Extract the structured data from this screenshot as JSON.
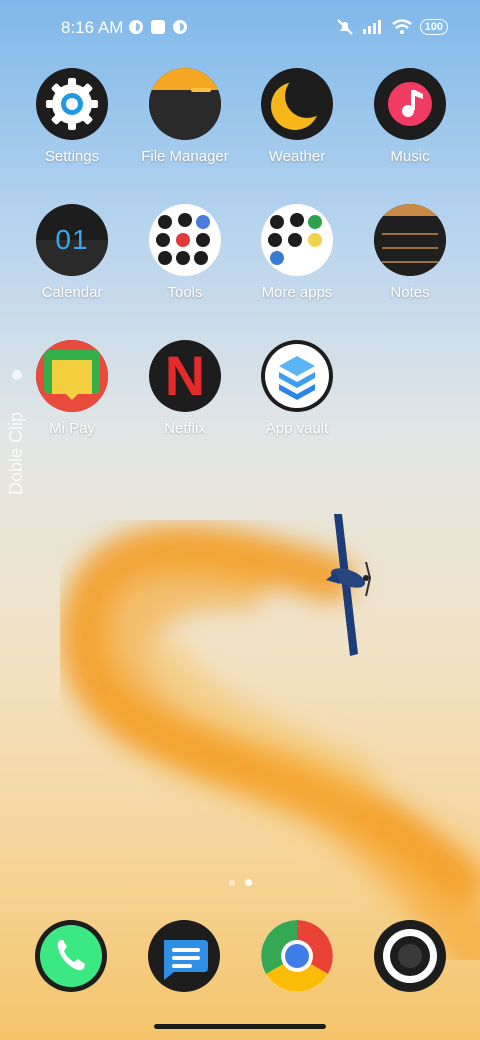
{
  "status_bar": {
    "time": "8:16 AM",
    "battery": "100",
    "icons": [
      "notification-icon",
      "square-icon",
      "notification-icon",
      "mute-icon",
      "signal-icon",
      "wifi-icon",
      "battery-icon"
    ]
  },
  "apps": [
    {
      "label": "Settings",
      "icon": "gear-icon"
    },
    {
      "label": "File Manager",
      "icon": "folder-icon"
    },
    {
      "label": "Weather",
      "icon": "moon-icon"
    },
    {
      "label": "Music",
      "icon": "music-note-icon"
    },
    {
      "label": "Calendar",
      "icon": "calendar-icon",
      "text": "01"
    },
    {
      "label": "Tools",
      "icon": "tools-folder-icon"
    },
    {
      "label": "More apps",
      "icon": "apps-folder-icon"
    },
    {
      "label": "Notes",
      "icon": "notes-icon"
    },
    {
      "label": "Mi Pay",
      "icon": "wallet-icon"
    },
    {
      "label": "Netflix",
      "icon": "netflix-icon",
      "text": "N"
    },
    {
      "label": "App vault",
      "icon": "app-vault-icon"
    }
  ],
  "side_widget": {
    "label": "Doble Clip"
  },
  "page_indicator": {
    "pages": 2,
    "current": 2
  },
  "dock": [
    {
      "name": "Phone",
      "icon": "phone-icon"
    },
    {
      "name": "Messages",
      "icon": "message-icon"
    },
    {
      "name": "Chrome",
      "icon": "chrome-icon"
    },
    {
      "name": "Camera",
      "icon": "camera-icon"
    }
  ]
}
